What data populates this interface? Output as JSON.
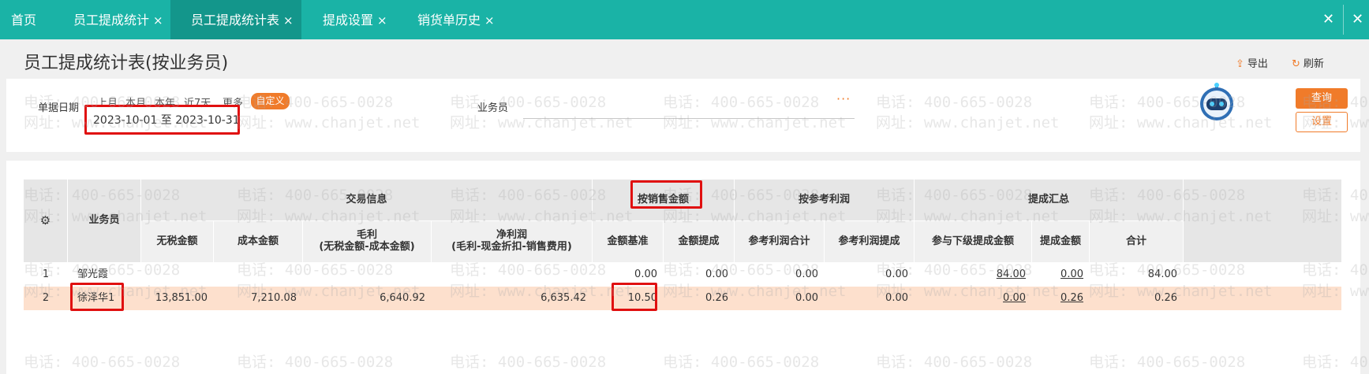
{
  "tabs": [
    {
      "label": "首页",
      "closable": false
    },
    {
      "label": "员工提成统计",
      "closable": true
    },
    {
      "label": "员工提成统计表",
      "closable": true,
      "active": true
    },
    {
      "label": "提成设置",
      "closable": true
    },
    {
      "label": "销货单历史",
      "closable": true
    }
  ],
  "tab_close_glyph": "×",
  "window_close_glyph": "✕",
  "page_title": "员工提成统计表(按业务员)",
  "header_actions": {
    "export": "导出",
    "refresh": "刷新"
  },
  "filter": {
    "date_label": "单据日期",
    "quick_ranges": [
      "上月",
      "本月",
      "本年",
      "近7天",
      "更多"
    ],
    "custom_label": "自定义",
    "date_range": "2023-10-01 至 2023-10-31",
    "salesperson_label": "业务员",
    "more_glyph": "···",
    "query_button": "查询",
    "setting_button": "设置"
  },
  "table": {
    "salesperson_header": "业务员",
    "groups": [
      "交易信息",
      "按销售金额",
      "按参考利润",
      "提成汇总"
    ],
    "columns": {
      "untaxed": "无税金额",
      "cost": "成本金额",
      "gross_1": "毛利",
      "gross_2": "(无税金额-成本金额)",
      "net_1": "净利润",
      "net_2": "(毛利-现金折扣-销售费用)",
      "base": "金额基准",
      "commission": "金额提成",
      "ref_total": "参考利润合计",
      "ref_commission": "参考利润提成",
      "sub_commission": "参与下级提成金额",
      "commission_amount": "提成金额",
      "total": "合计"
    },
    "rows": [
      {
        "no": "1",
        "salesperson": "邹光霞",
        "untaxed": "",
        "cost": "",
        "gross": "",
        "net": "",
        "base": "0.00",
        "commission": "0.00",
        "ref_total": "0.00",
        "ref_commission": "0.00",
        "sub_commission": "84.00",
        "commission_amount": "0.00",
        "total": "84.00"
      },
      {
        "no": "2",
        "salesperson": "徐泽华1",
        "untaxed": "13,851.00",
        "cost": "7,210.08",
        "gross": "6,640.92",
        "net": "6,635.42",
        "base": "10.50",
        "commission": "0.26",
        "ref_total": "0.00",
        "ref_commission": "0.00",
        "sub_commission": "0.00",
        "commission_amount": "0.26",
        "total": "0.26"
      }
    ]
  },
  "watermark": {
    "phone": "电话: 400-665-0028",
    "site": "网址: www.chanjet.net"
  },
  "colors": {
    "tab_bar": "#1ab3a6",
    "tab_active": "#13968b",
    "accent": "#f07b2a",
    "highlight_row": "#fde0cd",
    "annotation": "#e01010"
  }
}
